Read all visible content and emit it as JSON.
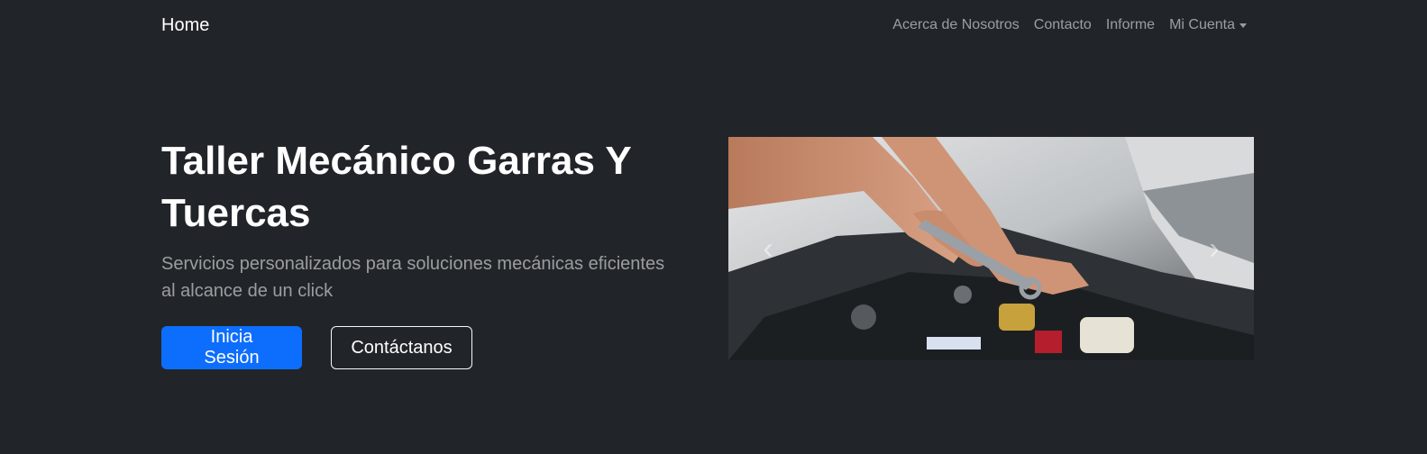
{
  "navbar": {
    "brand": "Home",
    "links": [
      {
        "label": "Acerca de Nosotros"
      },
      {
        "label": "Contacto"
      },
      {
        "label": "Informe"
      },
      {
        "label": "Mi Cuenta"
      }
    ]
  },
  "hero": {
    "title": "Taller Mecánico Garras Y Tuercas",
    "subtitle": "Servicios personalizados para soluciones mecánicas eficientes al alcance de un click",
    "primary_button": "Inicia Sesión",
    "secondary_button": "Contáctanos"
  },
  "carousel": {
    "image_description": "mechanic-wrench-engine-photo",
    "prev_icon": "chevron-left-icon",
    "next_icon": "chevron-right-icon"
  },
  "colors": {
    "background": "#212529",
    "primary": "#0d6efd",
    "nav_text": "rgba(255,255,255,0.55)"
  }
}
